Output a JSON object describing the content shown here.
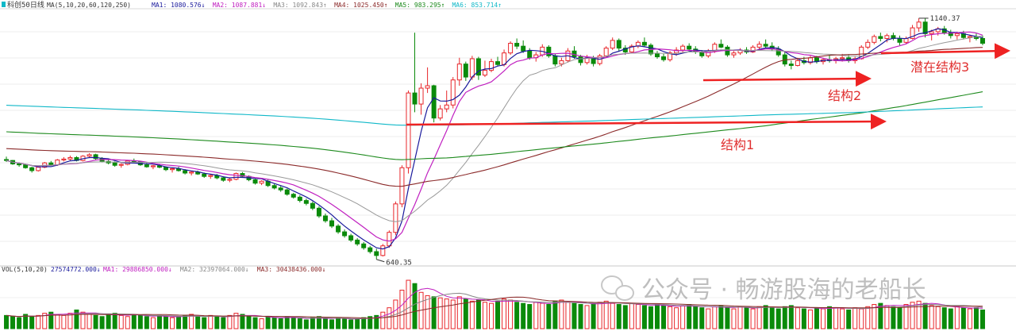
{
  "chart_data": {
    "type": "candlestick",
    "title": "科创50日线",
    "main_legend": {
      "prefix": "MA(5,10,20,60,120,250)",
      "items": [
        {
          "label": "MA1:",
          "value": "1080.576",
          "dir": "↓",
          "color": "#1a1a9c"
        },
        {
          "label": "MA2:",
          "value": "1087.881",
          "dir": "↓",
          "color": "#c020c0"
        },
        {
          "label": "MA3:",
          "value": "1092.843",
          "dir": "↑",
          "color": "#888888"
        },
        {
          "label": "MA4:",
          "value": "1025.450",
          "dir": "↑",
          "color": "#8b2a2a"
        },
        {
          "label": "MA5:",
          "value": "983.295",
          "dir": "↑",
          "color": "#1d8a1d"
        },
        {
          "label": "MA6:",
          "value": "853.714",
          "dir": "↑",
          "color": "#10b8c8"
        }
      ]
    },
    "ylim": [
      628,
      1158
    ],
    "price_labels": {
      "high": "1140.37",
      "low": "640.35"
    },
    "candles": [
      [
        847,
        853,
        842,
        845
      ],
      [
        845,
        846,
        836,
        838
      ],
      [
        838,
        841,
        832,
        836
      ],
      [
        836,
        838,
        828,
        830
      ],
      [
        830,
        832,
        820,
        824
      ],
      [
        824,
        833,
        822,
        831
      ],
      [
        831,
        842,
        829,
        840
      ],
      [
        840,
        844,
        834,
        836
      ],
      [
        836,
        848,
        834,
        846
      ],
      [
        846,
        852,
        843,
        848
      ],
      [
        848,
        855,
        845,
        851
      ],
      [
        851,
        854,
        843,
        845
      ],
      [
        845,
        856,
        843,
        854
      ],
      [
        854,
        860,
        850,
        857
      ],
      [
        857,
        859,
        846,
        849
      ],
      [
        849,
        852,
        841,
        843
      ],
      [
        843,
        847,
        837,
        840
      ],
      [
        840,
        843,
        832,
        835
      ],
      [
        835,
        839,
        830,
        837
      ],
      [
        837,
        846,
        835,
        844
      ],
      [
        844,
        849,
        840,
        842
      ],
      [
        842,
        844,
        834,
        836
      ],
      [
        836,
        840,
        830,
        832
      ],
      [
        832,
        836,
        827,
        834
      ],
      [
        834,
        838,
        829,
        831
      ],
      [
        831,
        833,
        823,
        826
      ],
      [
        826,
        830,
        820,
        828
      ],
      [
        828,
        832,
        822,
        824
      ],
      [
        824,
        827,
        816,
        819
      ],
      [
        819,
        823,
        814,
        821
      ],
      [
        821,
        824,
        815,
        817
      ],
      [
        817,
        820,
        809,
        812
      ],
      [
        812,
        816,
        807,
        814
      ],
      [
        814,
        817,
        806,
        809
      ],
      [
        809,
        812,
        801,
        804
      ],
      [
        804,
        809,
        800,
        806
      ],
      [
        806,
        820,
        804,
        818
      ],
      [
        818,
        821,
        809,
        812
      ],
      [
        812,
        814,
        802,
        805
      ],
      [
        805,
        808,
        795,
        798
      ],
      [
        798,
        804,
        794,
        802
      ],
      [
        802,
        806,
        790,
        793
      ],
      [
        793,
        797,
        785,
        788
      ],
      [
        788,
        792,
        780,
        784
      ],
      [
        784,
        787,
        772,
        775
      ],
      [
        775,
        778,
        766,
        769
      ],
      [
        769,
        773,
        758,
        762
      ],
      [
        762,
        766,
        752,
        756
      ],
      [
        756,
        760,
        742,
        746
      ],
      [
        746,
        750,
        726,
        730
      ],
      [
        730,
        735,
        716,
        720
      ],
      [
        720,
        726,
        705,
        709
      ],
      [
        709,
        713,
        693,
        697
      ],
      [
        697,
        702,
        685,
        689
      ],
      [
        689,
        693,
        676,
        680
      ],
      [
        680,
        684,
        668,
        672
      ],
      [
        672,
        676,
        660,
        664
      ],
      [
        664,
        668,
        652,
        656
      ],
      [
        656,
        662,
        640,
        648
      ],
      [
        648,
        672,
        646,
        668
      ],
      [
        668,
        700,
        664,
        696
      ],
      [
        696,
        760,
        690,
        755
      ],
      [
        755,
        835,
        748,
        830
      ],
      [
        830,
        990,
        818,
        985
      ],
      [
        985,
        1110,
        945,
        962
      ],
      [
        962,
        1005,
        940,
        995
      ],
      [
        995,
        1038,
        985,
        1000
      ],
      [
        1000,
        1002,
        924,
        933
      ],
      [
        933,
        960,
        928,
        952
      ],
      [
        952,
        990,
        945,
        960
      ],
      [
        960,
        1018,
        953,
        1012
      ],
      [
        1012,
        1058,
        1000,
        1045
      ],
      [
        1045,
        1050,
        1010,
        1018
      ],
      [
        1018,
        1062,
        1012,
        1056
      ],
      [
        1056,
        1060,
        1012,
        1022
      ],
      [
        1022,
        1052,
        1018,
        1032
      ],
      [
        1032,
        1056,
        1028,
        1050
      ],
      [
        1050,
        1060,
        1040,
        1044
      ],
      [
        1044,
        1075,
        1040,
        1068
      ],
      [
        1068,
        1092,
        1064,
        1088
      ],
      [
        1088,
        1098,
        1076,
        1082
      ],
      [
        1082,
        1094,
        1068,
        1072
      ],
      [
        1072,
        1078,
        1054,
        1058
      ],
      [
        1058,
        1070,
        1050,
        1064
      ],
      [
        1064,
        1086,
        1060,
        1080
      ],
      [
        1080,
        1084,
        1058,
        1062
      ],
      [
        1062,
        1066,
        1040,
        1045
      ],
      [
        1045,
        1058,
        1040,
        1052
      ],
      [
        1052,
        1078,
        1048,
        1072
      ],
      [
        1072,
        1082,
        1056,
        1060
      ],
      [
        1060,
        1064,
        1042,
        1048
      ],
      [
        1048,
        1064,
        1044,
        1058
      ],
      [
        1058,
        1062,
        1040,
        1046
      ],
      [
        1046,
        1066,
        1042,
        1062
      ],
      [
        1062,
        1082,
        1058,
        1078
      ],
      [
        1078,
        1100,
        1074,
        1094
      ],
      [
        1094,
        1098,
        1072,
        1078
      ],
      [
        1078,
        1084,
        1064,
        1070
      ],
      [
        1070,
        1086,
        1068,
        1082
      ],
      [
        1082,
        1094,
        1078,
        1090
      ],
      [
        1090,
        1100,
        1080,
        1084
      ],
      [
        1084,
        1088,
        1062,
        1066
      ],
      [
        1066,
        1072,
        1056,
        1060
      ],
      [
        1060,
        1066,
        1050,
        1054
      ],
      [
        1054,
        1072,
        1050,
        1068
      ],
      [
        1068,
        1080,
        1062,
        1074
      ],
      [
        1074,
        1086,
        1070,
        1082
      ],
      [
        1082,
        1088,
        1072,
        1076
      ],
      [
        1076,
        1082,
        1066,
        1070
      ],
      [
        1070,
        1074,
        1058,
        1062
      ],
      [
        1062,
        1076,
        1058,
        1072
      ],
      [
        1072,
        1090,
        1068,
        1086
      ],
      [
        1086,
        1096,
        1078,
        1080
      ],
      [
        1080,
        1084,
        1060,
        1064
      ],
      [
        1064,
        1072,
        1058,
        1068
      ],
      [
        1068,
        1078,
        1064,
        1074
      ],
      [
        1074,
        1080,
        1066,
        1070
      ],
      [
        1070,
        1084,
        1068,
        1080
      ],
      [
        1080,
        1092,
        1074,
        1086
      ],
      [
        1086,
        1096,
        1078,
        1082
      ],
      [
        1082,
        1090,
        1072,
        1076
      ],
      [
        1076,
        1082,
        1060,
        1064
      ],
      [
        1064,
        1070,
        1040,
        1045
      ],
      [
        1045,
        1052,
        1034,
        1042
      ],
      [
        1042,
        1058,
        1040,
        1052
      ],
      [
        1052,
        1060,
        1044,
        1048
      ],
      [
        1048,
        1062,
        1044,
        1058
      ],
      [
        1058,
        1062,
        1046,
        1050
      ],
      [
        1050,
        1058,
        1044,
        1054
      ],
      [
        1054,
        1064,
        1048,
        1052
      ],
      [
        1052,
        1060,
        1046,
        1056
      ],
      [
        1056,
        1066,
        1050,
        1058
      ],
      [
        1058,
        1064,
        1048,
        1052
      ],
      [
        1052,
        1060,
        1046,
        1056
      ],
      [
        1056,
        1084,
        1054,
        1080
      ],
      [
        1080,
        1096,
        1076,
        1090
      ],
      [
        1090,
        1106,
        1086,
        1102
      ],
      [
        1102,
        1110,
        1092,
        1098
      ],
      [
        1098,
        1108,
        1090,
        1104
      ],
      [
        1104,
        1110,
        1094,
        1098
      ],
      [
        1098,
        1104,
        1084,
        1090
      ],
      [
        1090,
        1102,
        1086,
        1098
      ],
      [
        1098,
        1126,
        1096,
        1120
      ],
      [
        1120,
        1140,
        1112,
        1132
      ],
      [
        1132,
        1140,
        1100,
        1108
      ],
      [
        1108,
        1116,
        1094,
        1112
      ],
      [
        1112,
        1122,
        1104,
        1118
      ],
      [
        1118,
        1124,
        1106,
        1110
      ],
      [
        1110,
        1116,
        1098,
        1104
      ],
      [
        1104,
        1112,
        1096,
        1108
      ],
      [
        1108,
        1114,
        1096,
        1100
      ],
      [
        1100,
        1106,
        1090,
        1102
      ],
      [
        1102,
        1108,
        1094,
        1098
      ],
      [
        1098,
        1104,
        1084,
        1088
      ]
    ],
    "volume": {
      "legend": {
        "prefix": "VOL(5,10,20)",
        "main": {
          "value": "27574772.000",
          "dir": "↓"
        },
        "items": [
          {
            "label": "MA1:",
            "value": "29886850.000",
            "dir": "↓",
            "color": "#c020c0"
          },
          {
            "label": "MA2:",
            "value": "32397064.000",
            "dir": "↓",
            "color": "#888888"
          },
          {
            "label": "MA3:",
            "value": "30438436.000",
            "dir": "↓",
            "color": "#8b2a2a"
          }
        ]
      },
      "values": [
        24,
        22,
        20,
        26,
        22,
        24,
        28,
        30,
        26,
        24,
        28,
        34,
        30,
        26,
        24,
        22,
        26,
        28,
        24,
        22,
        26,
        24,
        22,
        20,
        24,
        22,
        20,
        22,
        24,
        26,
        22,
        20,
        24,
        22,
        20,
        24,
        28,
        26,
        22,
        20,
        18,
        22,
        20,
        18,
        22,
        20,
        18,
        16,
        20,
        22,
        18,
        16,
        20,
        18,
        16,
        18,
        20,
        22,
        24,
        30,
        38,
        52,
        70,
        88,
        82,
        66,
        60,
        58,
        56,
        54,
        52,
        58,
        54,
        50,
        52,
        48,
        46,
        50,
        54,
        52,
        48,
        46,
        44,
        48,
        46,
        44,
        50,
        52,
        48,
        46,
        44,
        42,
        46,
        48,
        50,
        46,
        44,
        42,
        46,
        44,
        42,
        40,
        44,
        42,
        40,
        38,
        42,
        44,
        40,
        38,
        36,
        40,
        42,
        38,
        36,
        40,
        38,
        36,
        40,
        42,
        38,
        36,
        40,
        42,
        38,
        36,
        34,
        38,
        36,
        40,
        38,
        36,
        34,
        38,
        36,
        40,
        44,
        46,
        42,
        40,
        38,
        44,
        48,
        50,
        46,
        42,
        40,
        38,
        36,
        40,
        38,
        36,
        38,
        34
      ]
    },
    "annotations": [
      "结构1",
      "结构2",
      "潜在结构3"
    ],
    "watermark": "公众号 · 畅游股海的老船长"
  }
}
